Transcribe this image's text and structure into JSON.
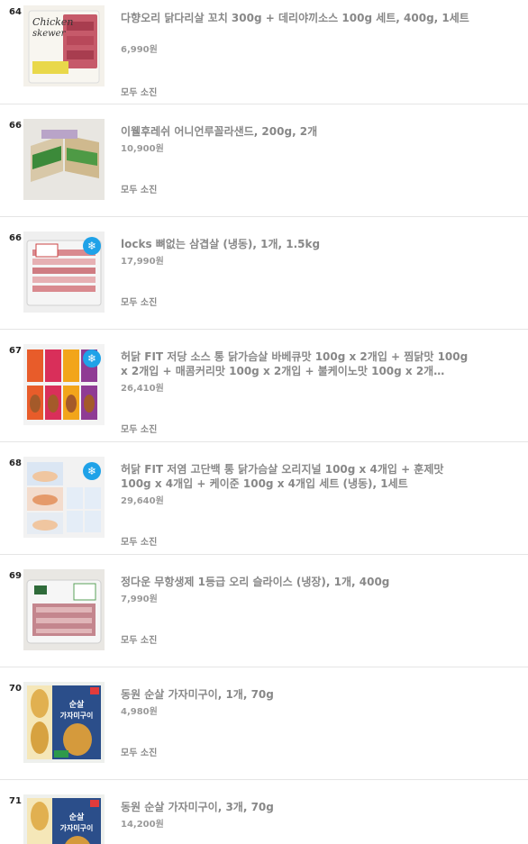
{
  "colors": {
    "text_gray": "#888888",
    "divider": "#e5e5e5",
    "freeze_badge": "#1fa2e8"
  },
  "products": [
    {
      "rank": "64",
      "title": "다향오리 닭다리살 꼬치 300g + 데리야끼소스 100g 세트, 400g, 1세트",
      "price": "6,990원",
      "status": "모두 소진",
      "frozen": false,
      "thumb_text": "Chicken skewer"
    },
    {
      "rank": "66",
      "title": "이웰후레쉬 어니언루꼴라샌드, 200g, 2개",
      "price": "10,900원",
      "status": "모두 소진",
      "frozen": false
    },
    {
      "rank": "66",
      "title": "locks 뼈없는 삼겹살 (냉동), 1개, 1.5kg",
      "price": "17,990원",
      "status": "모두 소진",
      "frozen": true
    },
    {
      "rank": "67",
      "title": "허닭 FIT 저당 소스 통 닭가슴살 바베큐맛 100g x 2개입 + 찜닭맛 100g x 2개입 + 매콤커리맛 100g x 2개입 + 불케이노맛 100g x 2개…",
      "price": "26,410원",
      "status": "모두 소진",
      "frozen": true
    },
    {
      "rank": "68",
      "title": "허닭 FIT 저염 고단백 통 닭가슴살 오리지널 100g x 4개입 + 훈제맛 100g x 4개입 + 케이준 100g x 4개입 세트 (냉동), 1세트",
      "price": "29,640원",
      "status": "모두 소진",
      "frozen": true
    },
    {
      "rank": "69",
      "title": "정다운 무항생제 1등급 오리 슬라이스 (냉장), 1개, 400g",
      "price": "7,990원",
      "status": "모두 소진",
      "frozen": false
    },
    {
      "rank": "70",
      "title": "동원 순살 가자미구이, 1개, 70g",
      "price": "4,980원",
      "status": "모두 소진",
      "frozen": false,
      "thumb_text": "순살 가자미구이"
    },
    {
      "rank": "71",
      "title": "동원 순살 가자미구이, 3개, 70g",
      "price": "14,200원",
      "status": "",
      "frozen": false,
      "thumb_text": "순살 가자미구이"
    }
  ],
  "freeze_icon": "snowflake-icon",
  "freeze_glyph": "❄"
}
